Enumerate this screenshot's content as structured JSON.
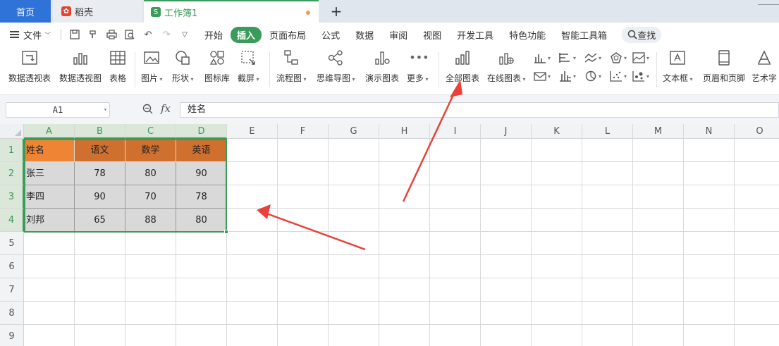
{
  "tabs": {
    "home": "首页",
    "daoke": "稻壳",
    "workbook": "工作簿1",
    "add": "+"
  },
  "menu": {
    "file": "文件",
    "tabs": [
      "开始",
      "插入",
      "页面布局",
      "公式",
      "数据",
      "审阅",
      "视图",
      "开发工具",
      "特色功能",
      "智能工具箱"
    ],
    "active_tab": "插入",
    "search": "查找"
  },
  "ribbon": {
    "pivot_table": "数据透视表",
    "pivot_chart": "数据透视图",
    "table": "表格",
    "picture": "图片",
    "shape": "形状",
    "icon_lib": "图标库",
    "screenshot": "截屏",
    "flowchart": "流程图",
    "mindmap": "思维导图",
    "demo_chart": "演示图表",
    "more": "更多",
    "all_charts": "全部图表",
    "online_chart": "在线图表",
    "textbox": "文本框",
    "header_footer": "页眉和页脚",
    "wordart": "艺术字"
  },
  "formula": {
    "cell_ref": "A1",
    "fx": "fx",
    "value": "姓名"
  },
  "sheet": {
    "columns": [
      "A",
      "B",
      "C",
      "D",
      "E",
      "F",
      "G",
      "H",
      "I",
      "J",
      "K",
      "L",
      "M",
      "N",
      "O"
    ],
    "rows": [
      "1",
      "2",
      "3",
      "4",
      "5",
      "6",
      "7",
      "8",
      "9"
    ],
    "data": [
      [
        "姓名",
        "语文",
        "数学",
        "英语"
      ],
      [
        "张三",
        "78",
        "80",
        "90"
      ],
      [
        "李四",
        "90",
        "70",
        "78"
      ],
      [
        "刘邦",
        "65",
        "88",
        "80"
      ]
    ]
  },
  "colors": {
    "accent": "#3a9b5a",
    "home_tab": "#2f73d9",
    "header_first": "#ef8434",
    "header": "#d0702f",
    "arrow": "#e8423a"
  }
}
